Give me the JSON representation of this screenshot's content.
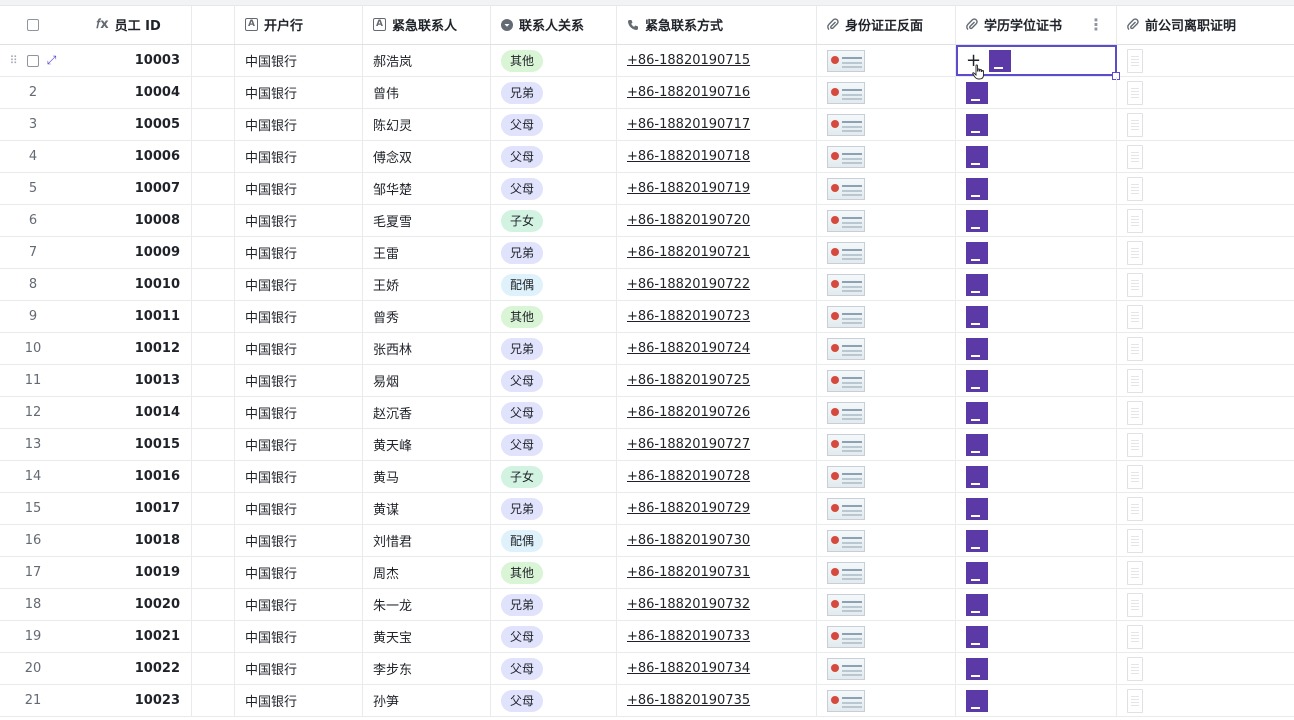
{
  "headers": {
    "employee_id": "员工 ID",
    "bank": "开户行",
    "emergency_contact": "紧急联系人",
    "relationship": "联系人关系",
    "emergency_phone": "紧急联系方式",
    "id_card": "身份证正反面",
    "degree_cert": "学历学位证书",
    "resignation_cert": "前公司离职证明",
    "formula_icon": "𝑓x"
  },
  "rows": [
    {
      "num": "",
      "id": "10003",
      "bank": "中国银行",
      "contact": "郝浩岚",
      "rel": "其他",
      "rel_type": "other",
      "phone": "+86-18820190715"
    },
    {
      "num": "2",
      "id": "10004",
      "bank": "中国银行",
      "contact": "曾伟",
      "rel": "兄弟",
      "rel_type": "brother",
      "phone": "+86-18820190716"
    },
    {
      "num": "3",
      "id": "10005",
      "bank": "中国银行",
      "contact": "陈幻灵",
      "rel": "父母",
      "rel_type": "parent",
      "phone": "+86-18820190717"
    },
    {
      "num": "4",
      "id": "10006",
      "bank": "中国银行",
      "contact": "傅念双",
      "rel": "父母",
      "rel_type": "parent",
      "phone": "+86-18820190718"
    },
    {
      "num": "5",
      "id": "10007",
      "bank": "中国银行",
      "contact": "邹华楚",
      "rel": "父母",
      "rel_type": "parent",
      "phone": "+86-18820190719"
    },
    {
      "num": "6",
      "id": "10008",
      "bank": "中国银行",
      "contact": "毛夏雪",
      "rel": "子女",
      "rel_type": "child",
      "phone": "+86-18820190720"
    },
    {
      "num": "7",
      "id": "10009",
      "bank": "中国银行",
      "contact": "王雷",
      "rel": "兄弟",
      "rel_type": "brother",
      "phone": "+86-18820190721"
    },
    {
      "num": "8",
      "id": "10010",
      "bank": "中国银行",
      "contact": "王娇",
      "rel": "配偶",
      "rel_type": "spouse",
      "phone": "+86-18820190722"
    },
    {
      "num": "9",
      "id": "10011",
      "bank": "中国银行",
      "contact": "曾秀",
      "rel": "其他",
      "rel_type": "other",
      "phone": "+86-18820190723"
    },
    {
      "num": "10",
      "id": "10012",
      "bank": "中国银行",
      "contact": "张西林",
      "rel": "兄弟",
      "rel_type": "brother",
      "phone": "+86-18820190724"
    },
    {
      "num": "11",
      "id": "10013",
      "bank": "中国银行",
      "contact": "易烟",
      "rel": "父母",
      "rel_type": "parent",
      "phone": "+86-18820190725"
    },
    {
      "num": "12",
      "id": "10014",
      "bank": "中国银行",
      "contact": "赵沉香",
      "rel": "父母",
      "rel_type": "parent",
      "phone": "+86-18820190726"
    },
    {
      "num": "13",
      "id": "10015",
      "bank": "中国银行",
      "contact": "黄天峰",
      "rel": "父母",
      "rel_type": "parent",
      "phone": "+86-18820190727"
    },
    {
      "num": "14",
      "id": "10016",
      "bank": "中国银行",
      "contact": "黄马",
      "rel": "子女",
      "rel_type": "child",
      "phone": "+86-18820190728"
    },
    {
      "num": "15",
      "id": "10017",
      "bank": "中国银行",
      "contact": "黄谋",
      "rel": "兄弟",
      "rel_type": "brother",
      "phone": "+86-18820190729"
    },
    {
      "num": "16",
      "id": "10018",
      "bank": "中国银行",
      "contact": "刘惜君",
      "rel": "配偶",
      "rel_type": "spouse",
      "phone": "+86-18820190730"
    },
    {
      "num": "17",
      "id": "10019",
      "bank": "中国银行",
      "contact": "周杰",
      "rel": "其他",
      "rel_type": "other",
      "phone": "+86-18820190731"
    },
    {
      "num": "18",
      "id": "10020",
      "bank": "中国银行",
      "contact": "朱一龙",
      "rel": "兄弟",
      "rel_type": "brother",
      "phone": "+86-18820190732"
    },
    {
      "num": "19",
      "id": "10021",
      "bank": "中国银行",
      "contact": "黄天宝",
      "rel": "父母",
      "rel_type": "parent",
      "phone": "+86-18820190733"
    },
    {
      "num": "20",
      "id": "10022",
      "bank": "中国银行",
      "contact": "李步东",
      "rel": "父母",
      "rel_type": "parent",
      "phone": "+86-18820190734"
    },
    {
      "num": "21",
      "id": "10023",
      "bank": "中国银行",
      "contact": "孙笋",
      "rel": "父母",
      "rel_type": "parent",
      "phone": "+86-18820190735"
    }
  ],
  "colors": {
    "accent": "#5b4ccc",
    "degree_thumb": "#5b3aa8"
  }
}
